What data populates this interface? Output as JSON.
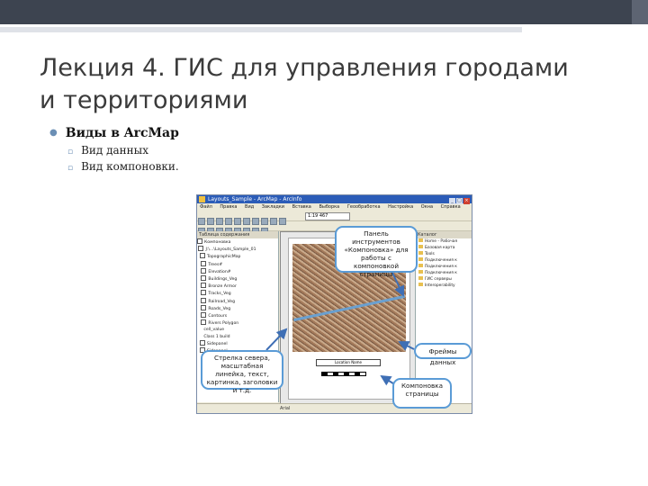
{
  "slide": {
    "title_line1": "Лекция 4. ГИС для управления городами",
    "title_line2": "и территориями",
    "bullet_main": "Виды в ArcMap",
    "bullet_sub": [
      "Вид данных",
      "Вид компоновки."
    ]
  },
  "screenshot": {
    "window_title": "Layouts_Sample - ArcMap - ArcInfo",
    "menu_items": [
      "Файл",
      "Правка",
      "Вид",
      "Закладки",
      "Вставка",
      "Выборка",
      "Геообработка",
      "Настройка",
      "Окна",
      "Справка"
    ],
    "scale_value": "1:19 467",
    "toc_title": "Таблица содержания",
    "toc_rows": [
      "Компоновка",
      "J:\\...\\Layouts_Sample_01",
      "TopographicMap",
      "Trees#",
      "Elevation#",
      "Buildings_Veg",
      "Bronze Armor",
      "Tracks_Veg",
      "Railroad_Veg",
      "Roads_Veg",
      "Contours",
      "Rivers Polygon",
      "cell_value",
      "Class 1 build",
      "Sidepanel",
      "Sidepanel"
    ],
    "catalog_title": "Каталог",
    "catalog_rows": [
      "Home - Рабочая",
      "Базовая карта",
      "Tools",
      "Подключения к",
      "Подключения к",
      "Подключения к",
      "ГИС серверы",
      "Interoperability"
    ],
    "map_legend": "Location Name",
    "status_font": "Arial"
  },
  "callouts": {
    "layout_toolbar": "Панель инструментов «Компоновка» для работы с компоновкой страницы",
    "elements": "Стрелка севера, масштабная линейка, текст, картинка, заголовки и т.д.",
    "frames": "Фреймы данных",
    "page": "Компоновка страницы"
  },
  "colors": {
    "topbar": "#3d4450",
    "bullet_dot": "#6b8fb5",
    "callout_border": "#5a9bd6",
    "arrow": "#3f6fb5"
  }
}
